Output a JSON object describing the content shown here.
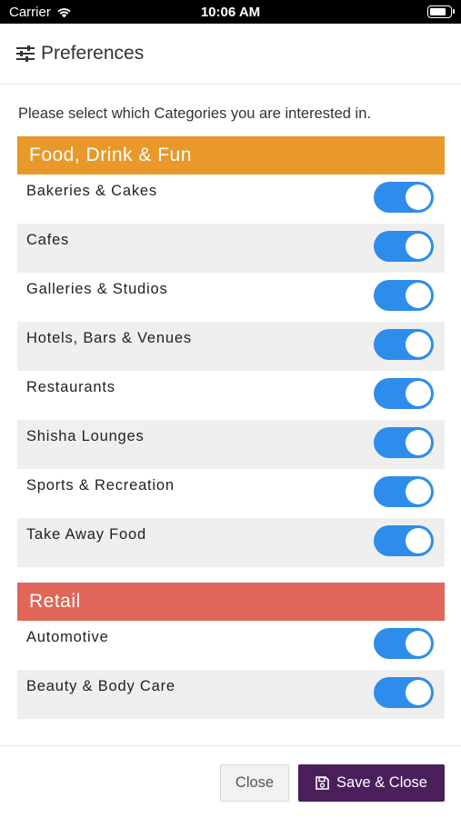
{
  "status_bar": {
    "carrier": "Carrier",
    "time": "10:06 AM",
    "wifi_icon": "wifi-icon",
    "battery_level": 0.85
  },
  "header": {
    "icon": "sliders-icon",
    "title": "Preferences"
  },
  "intro": "Please select which Categories you are interested in.",
  "sections": [
    {
      "title": "Food, Drink & Fun",
      "color": "#E8992A",
      "items": [
        {
          "label": "Bakeries & Cakes",
          "on": true
        },
        {
          "label": "Cafes",
          "on": true
        },
        {
          "label": "Galleries & Studios",
          "on": true
        },
        {
          "label": "Hotels, Bars & Venues",
          "on": true
        },
        {
          "label": "Restaurants",
          "on": true
        },
        {
          "label": "Shisha Lounges",
          "on": true
        },
        {
          "label": "Sports & Recreation",
          "on": true
        },
        {
          "label": "Take Away Food",
          "on": true
        }
      ]
    },
    {
      "title": "Retail",
      "color": "#DF6658",
      "items": [
        {
          "label": "Automotive",
          "on": true
        },
        {
          "label": "Beauty & Body Care",
          "on": true
        }
      ]
    }
  ],
  "footer": {
    "close_label": "Close",
    "save_label": "Save & Close",
    "save_icon": "floppy-disk-icon"
  },
  "colors": {
    "toggle_on": "#2E8CEB",
    "save_button": "#4A1F5C"
  }
}
